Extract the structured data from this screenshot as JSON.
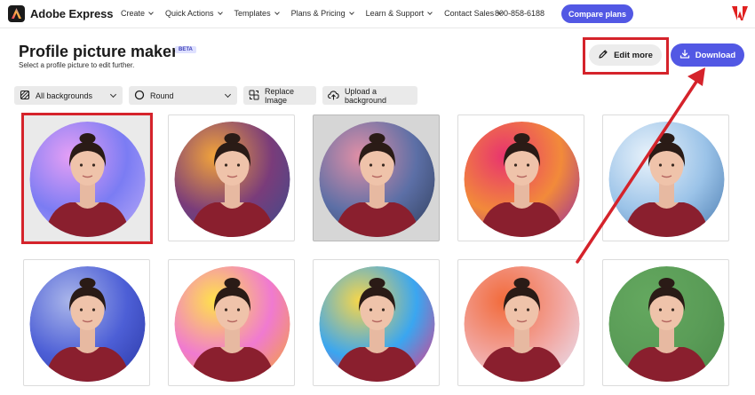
{
  "nav": {
    "brand": "Adobe Express",
    "menu": [
      {
        "label": "Create"
      },
      {
        "label": "Quick Actions"
      },
      {
        "label": "Templates"
      },
      {
        "label": "Plans & Pricing"
      },
      {
        "label": "Learn & Support"
      },
      {
        "label": "Contact Sales"
      }
    ],
    "phone": "800-858-6188",
    "compare_label": "Compare plans"
  },
  "header": {
    "title": "Profile picture maker",
    "badge": "BETA",
    "subtitle": "Select a profile picture to edit further.",
    "edit_label": "Edit more",
    "download_label": "Download"
  },
  "toolbar": {
    "backgrounds_label": "All backgrounds",
    "shape_label": "Round",
    "replace_label": "Replace Image",
    "upload_label": "Upload a background"
  },
  "colors": {
    "accent": "#5258e4",
    "annotation": "#d5232b",
    "shirt": "#8a1f2e"
  },
  "cards": [
    {
      "name": "background-lavender-sparkle",
      "c1": "#e59ff5",
      "c2": "#7b7cf3",
      "c3": "#b7a8f7"
    },
    {
      "name": "background-sunset-gradient",
      "c1": "#f2a43a",
      "c2": "#7a3c7a",
      "c3": "#3f4c8c"
    },
    {
      "name": "background-dusky-pink",
      "c1": "#e08fa6",
      "c2": "#5c6fa6",
      "c3": "#33415f"
    },
    {
      "name": "background-magenta-orange",
      "c1": "#e8336f",
      "c2": "#f28a3a",
      "c3": "#9b2f9a"
    },
    {
      "name": "background-blue-glow",
      "c1": "#eaf3fb",
      "c2": "#9bc3e8",
      "c3": "#4f7fb3"
    },
    {
      "name": "background-blue-knit",
      "c1": "#aab6ea",
      "c2": "#4d5fd6",
      "c3": "#2d3aa8"
    },
    {
      "name": "background-yellow-pink",
      "c1": "#ffe24a",
      "c2": "#f07ad0",
      "c3": "#f3a23a"
    },
    {
      "name": "background-rainbow",
      "c1": "#f7d64a",
      "c2": "#3aa6f0",
      "c3": "#e03b88"
    },
    {
      "name": "background-coral-pastel",
      "c1": "#f26a3a",
      "c2": "#f2a6a0",
      "c3": "#e8e0f0"
    },
    {
      "name": "background-green",
      "c1": "#64a85f",
      "c2": "#5a9c57",
      "c3": "#4d8d4b"
    }
  ]
}
